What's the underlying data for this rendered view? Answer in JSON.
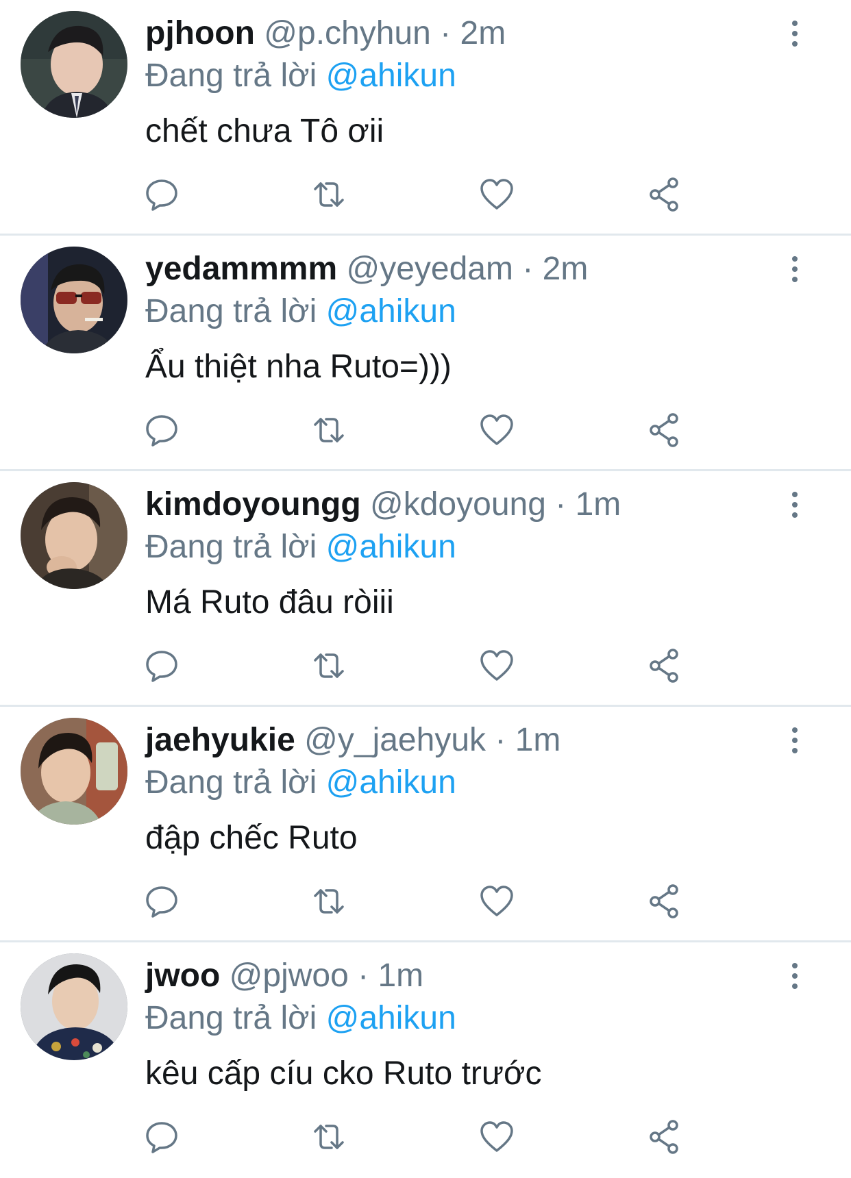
{
  "reply_prefix": "Đang trả lời",
  "colors": {
    "name": "#14171a",
    "secondary": "#657786",
    "mention": "#1da1f2",
    "divider": "#e1e8ed"
  },
  "icons": {
    "more": "more-vertical-icon",
    "reply": "comment-icon",
    "retweet": "retweet-icon",
    "like": "heart-icon",
    "share": "share-icon"
  },
  "tweets": [
    {
      "name": "pjhoon",
      "handle": "@p.chyhun",
      "dot": "·",
      "time": "2m",
      "reply_to": "@ahikun",
      "text": "chết chưa Tô ơii"
    },
    {
      "name": "yedammmm",
      "handle": "@yeyedam",
      "dot": "·",
      "time": "2m",
      "reply_to": "@ahikun",
      "text": "Ẩu thiệt nha Ruto=)))"
    },
    {
      "name": "kimdoyoungg",
      "handle": "@kdoyoung",
      "dot": "·",
      "time": "1m",
      "reply_to": "@ahikun",
      "text": "Má Ruto đâu ròiii"
    },
    {
      "name": "jaehyukie",
      "handle": "@y_jaehyuk",
      "dot": "·",
      "time": "1m",
      "reply_to": "@ahikun",
      "text": "đập chếc Ruto"
    },
    {
      "name": "jwoo",
      "handle": "@pjwoo",
      "dot": "·",
      "time": "1m",
      "reply_to": "@ahikun",
      "text": "kêu cấp cíu cko Ruto trước"
    }
  ]
}
